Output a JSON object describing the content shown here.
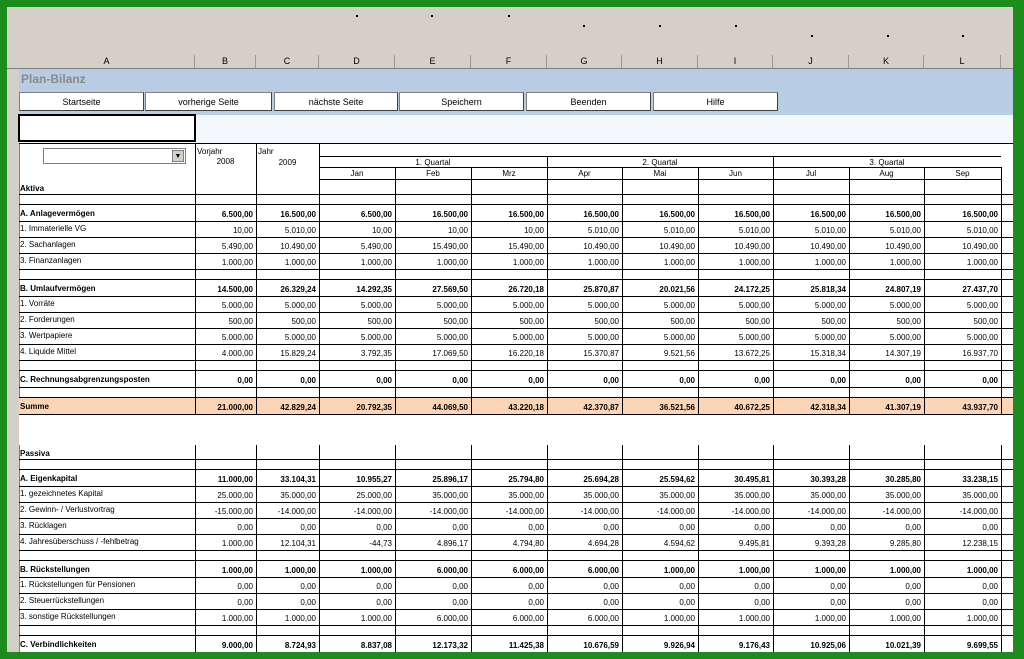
{
  "window": {
    "app_title": "Plan-Bilanz"
  },
  "columns": [
    "A",
    "B",
    "C",
    "D",
    "E",
    "F",
    "G",
    "H",
    "I",
    "J",
    "K",
    "L"
  ],
  "nav_buttons": [
    "Startseite",
    "vorherige Seite",
    "nächste Seite",
    "Speichern",
    "Beenden",
    "Hilfe"
  ],
  "header": {
    "vorjahr": "Vorjahr",
    "vorjahr_year": "2008",
    "jahr": "Jahr",
    "jahr_year": "2009",
    "quarters": [
      "1. Quartal",
      "2. Quartal",
      "3. Quartal"
    ],
    "months": [
      "Jan",
      "Feb",
      "Mrz",
      "Apr",
      "Mai",
      "Jun",
      "Jul",
      "Aug",
      "Sep"
    ]
  },
  "rows": [
    {
      "label": "Aktiva",
      "type": "section",
      "values": []
    },
    {
      "label": "",
      "type": "blank",
      "values": []
    },
    {
      "label": "A. Anlagevermögen",
      "type": "group",
      "values": [
        "6.500,00",
        "16.500,00",
        "6.500,00",
        "16.500,00",
        "16.500,00",
        "16.500,00",
        "16.500,00",
        "16.500,00",
        "16.500,00",
        "16.500,00",
        "16.500,00"
      ]
    },
    {
      "label": "1. Immaterielle VG",
      "type": "item",
      "values": [
        "10,00",
        "5.010,00",
        "10,00",
        "10,00",
        "10,00",
        "5.010,00",
        "5.010,00",
        "5.010,00",
        "5.010,00",
        "5.010,00",
        "5.010,00"
      ]
    },
    {
      "label": "2. Sachanlagen",
      "type": "item",
      "values": [
        "5.490,00",
        "10.490,00",
        "5.490,00",
        "15.490,00",
        "15.490,00",
        "10.490,00",
        "10.490,00",
        "10.490,00",
        "10.490,00",
        "10.490,00",
        "10.490,00"
      ]
    },
    {
      "label": "3. Finanzanlagen",
      "type": "item",
      "values": [
        "1.000,00",
        "1.000,00",
        "1.000,00",
        "1.000,00",
        "1.000,00",
        "1.000,00",
        "1.000,00",
        "1.000,00",
        "1.000,00",
        "1.000,00",
        "1.000,00"
      ]
    },
    {
      "label": "",
      "type": "blank",
      "values": []
    },
    {
      "label": "B. Umlaufvermögen",
      "type": "group",
      "values": [
        "14.500,00",
        "26.329,24",
        "14.292,35",
        "27.569,50",
        "26.720,18",
        "25.870,87",
        "20.021,56",
        "24.172,25",
        "25.818,34",
        "24.807,19",
        "27.437,70"
      ]
    },
    {
      "label": "1. Vorräte",
      "type": "item",
      "values": [
        "5.000,00",
        "5.000,00",
        "5.000,00",
        "5.000,00",
        "5.000,00",
        "5.000,00",
        "5.000,00",
        "5.000,00",
        "5.000,00",
        "5.000,00",
        "5.000,00"
      ]
    },
    {
      "label": "2. Forderungen",
      "type": "item",
      "values": [
        "500,00",
        "500,00",
        "500,00",
        "500,00",
        "500,00",
        "500,00",
        "500,00",
        "500,00",
        "500,00",
        "500,00",
        "500,00"
      ]
    },
    {
      "label": "3. Wertpapiere",
      "type": "item",
      "values": [
        "5.000,00",
        "5.000,00",
        "5.000,00",
        "5.000,00",
        "5.000,00",
        "5.000,00",
        "5.000,00",
        "5.000,00",
        "5.000,00",
        "5.000,00",
        "5.000,00"
      ]
    },
    {
      "label": "4. Liquide Mittel",
      "type": "item",
      "values": [
        "4.000,00",
        "15.829,24",
        "3.792,35",
        "17.069,50",
        "16.220,18",
        "15.370,87",
        "9.521,56",
        "13.672,25",
        "15.318,34",
        "14.307,19",
        "16.937,70"
      ]
    },
    {
      "label": "",
      "type": "blank",
      "values": []
    },
    {
      "label": "C. Rechnungsabgrenzungsposten",
      "type": "group",
      "values": [
        "0,00",
        "0,00",
        "0,00",
        "0,00",
        "0,00",
        "0,00",
        "0,00",
        "0,00",
        "0,00",
        "0,00",
        "0,00"
      ]
    },
    {
      "label": "",
      "type": "blank",
      "values": []
    },
    {
      "label": "Summe",
      "type": "sum",
      "values": [
        "21.000,00",
        "42.829,24",
        "20.792,35",
        "44.069,50",
        "43.220,18",
        "42.370,87",
        "36.521,56",
        "40.672,25",
        "42.318,34",
        "41.307,19",
        "43.937,70"
      ]
    },
    {
      "label": "",
      "type": "gap",
      "values": []
    },
    {
      "label": "Passiva",
      "type": "section",
      "values": []
    },
    {
      "label": "",
      "type": "blank",
      "values": []
    },
    {
      "label": "A. Eigenkapital",
      "type": "group",
      "values": [
        "11.000,00",
        "33.104,31",
        "10.955,27",
        "25.896,17",
        "25.794,80",
        "25.694,28",
        "25.594,62",
        "30.495,81",
        "30.393,28",
        "30.285,80",
        "33.238,15"
      ]
    },
    {
      "label": "1. gezeichnetes Kapital",
      "type": "item",
      "values": [
        "25.000,00",
        "35.000,00",
        "25.000,00",
        "35.000,00",
        "35.000,00",
        "35.000,00",
        "35.000,00",
        "35.000,00",
        "35.000,00",
        "35.000,00",
        "35.000,00"
      ]
    },
    {
      "label": "2. Gewinn- / Verlustvortrag",
      "type": "item",
      "values": [
        "-15.000,00",
        "-14.000,00",
        "-14.000,00",
        "-14.000,00",
        "-14.000,00",
        "-14.000,00",
        "-14.000,00",
        "-14.000,00",
        "-14.000,00",
        "-14.000,00",
        "-14.000,00"
      ]
    },
    {
      "label": "3. Rücklagen",
      "type": "item",
      "values": [
        "0,00",
        "0,00",
        "0,00",
        "0,00",
        "0,00",
        "0,00",
        "0,00",
        "0,00",
        "0,00",
        "0,00",
        "0,00"
      ]
    },
    {
      "label": "4. Jahresüberschuss / -fehlbetrag",
      "type": "item",
      "values": [
        "1.000,00",
        "12.104,31",
        "-44,73",
        "4.896,17",
        "4.794,80",
        "4.694,28",
        "4.594,62",
        "9.495,81",
        "9.393,28",
        "9.285,80",
        "12.238,15"
      ]
    },
    {
      "label": "",
      "type": "blank",
      "values": []
    },
    {
      "label": "B. Rückstellungen",
      "type": "group",
      "values": [
        "1.000,00",
        "1.000,00",
        "1.000,00",
        "6.000,00",
        "6.000,00",
        "6.000,00",
        "1.000,00",
        "1.000,00",
        "1.000,00",
        "1.000,00",
        "1.000,00"
      ]
    },
    {
      "label": "1. Rückstellungen für Pensionen",
      "type": "item",
      "values": [
        "0,00",
        "0,00",
        "0,00",
        "0,00",
        "0,00",
        "0,00",
        "0,00",
        "0,00",
        "0,00",
        "0,00",
        "0,00"
      ]
    },
    {
      "label": "2. Steuerrückstellungen",
      "type": "item",
      "values": [
        "0,00",
        "0,00",
        "0,00",
        "0,00",
        "0,00",
        "0,00",
        "0,00",
        "0,00",
        "0,00",
        "0,00",
        "0,00"
      ]
    },
    {
      "label": "3. sonstige Rückstellungen",
      "type": "item",
      "values": [
        "1.000,00",
        "1.000,00",
        "1.000,00",
        "6.000,00",
        "6.000,00",
        "6.000,00",
        "1.000,00",
        "1.000,00",
        "1.000,00",
        "1.000,00",
        "1.000,00"
      ]
    },
    {
      "label": "",
      "type": "blank",
      "values": []
    },
    {
      "label": "C. Verbindlichkeiten",
      "type": "group",
      "values": [
        "9.000,00",
        "8.724,93",
        "8.837,08",
        "12.173,32",
        "11.425,38",
        "10.676,59",
        "9.926,94",
        "9.176,43",
        "10.925,06",
        "10.021,39",
        "9.699,55"
      ]
    }
  ]
}
